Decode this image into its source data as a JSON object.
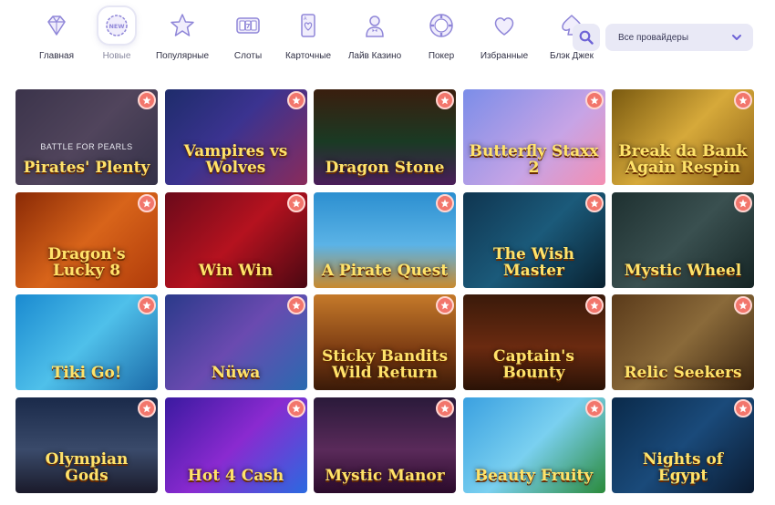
{
  "nav": {
    "items": [
      {
        "label": "Главная",
        "icon": "diamond-icon"
      },
      {
        "label": "Новые",
        "icon": "new-badge-icon",
        "active": true
      },
      {
        "label": "Популярные",
        "icon": "star-icon"
      },
      {
        "label": "Слоты",
        "icon": "slot-machine-icon"
      },
      {
        "label": "Карточные",
        "icon": "playing-card-icon"
      },
      {
        "label": "Лайв Казино",
        "icon": "dealer-icon"
      },
      {
        "label": "Покер",
        "icon": "poker-chip-icon"
      },
      {
        "label": "Избранные",
        "icon": "heart-icon"
      },
      {
        "label": "Блэк Джек",
        "icon": "spade-card-icon"
      }
    ]
  },
  "search": {
    "icon": "search-icon"
  },
  "providers": {
    "selected": "Все провайдеры",
    "icon": "chevron-down-icon"
  },
  "colors": {
    "accent": "#6d63d6",
    "badge": "#f2766c",
    "bar_bg": "#e9e9f6"
  },
  "games": [
    {
      "title": "Pirates' Plenty",
      "hover_text": "BATTLE FOR PEARLS",
      "overlay": true,
      "bg": "linear-gradient(135deg,#3b2a3a,#6a5060 50%,#2b2433)"
    },
    {
      "title": "Vampires vs Wolves",
      "bg": "linear-gradient(135deg,#1e2c6b,#3b3390 45%,#8a2b5b)"
    },
    {
      "title": "Dragon Stone",
      "bg": "linear-gradient(180deg,#3a1e0e,#1a3a24 55%,#4a1d5a)"
    },
    {
      "title": "Butterfly Staxx 2",
      "bg": "linear-gradient(135deg,#7b8de8,#c7a4e6 60%,#f48fb1)"
    },
    {
      "title": "Break da Bank Again Respin",
      "bg": "linear-gradient(135deg,#7a5a10,#d6a93a 50%,#8a5f15)"
    },
    {
      "title": "Dragon's Lucky 8",
      "bg": "linear-gradient(135deg,#8a2a06,#d8641a 50%,#b03b0a)"
    },
    {
      "title": "Win Win",
      "bg": "linear-gradient(135deg,#6a0a1a,#b5121f 50%,#4a0812)"
    },
    {
      "title": "A Pirate Quest",
      "bg": "linear-gradient(180deg,#2c8fd0,#5bb3e6 55%,#c88a2e)"
    },
    {
      "title": "The Wish Master",
      "bg": "linear-gradient(135deg,#0f3550,#1b5a7a 50%,#08202f)"
    },
    {
      "title": "Mystic Wheel",
      "bg": "linear-gradient(135deg,#1e3030,#3a5050 50%,#152424)"
    },
    {
      "title": "Tiki Go!",
      "bg": "linear-gradient(135deg,#1a8ad0,#4fc0ea 50%,#1b6aa8)"
    },
    {
      "title": "Nüwa",
      "bg": "linear-gradient(135deg,#2a3a8a,#6a4ab0 50%,#2a6ab0)"
    },
    {
      "title": "Sticky Bandits Wild Return",
      "bg": "linear-gradient(180deg,#c57a2a,#7a3a12 60%,#3a1a08)"
    },
    {
      "title": "Captain's Bounty",
      "bg": "linear-gradient(180deg,#3a1a0a,#6a2a10 55%,#2a1206)"
    },
    {
      "title": "Relic Seekers",
      "bg": "linear-gradient(135deg,#5a3a1a,#8a6a3a 50%,#3a2410)"
    },
    {
      "title": "Olympian Gods",
      "bg": "linear-gradient(180deg,#1a2a4a,#3a4a6a 55%,#1a1a2a)"
    },
    {
      "title": "Hot 4 Cash",
      "bg": "linear-gradient(135deg,#3a1aa0,#8a2ad0 50%,#2a6ae0)"
    },
    {
      "title": "Mystic Manor",
      "bg": "linear-gradient(180deg,#2a1a3a,#5a2a5a 55%,#2a0a2a)"
    },
    {
      "title": "Beauty Fruity",
      "bg": "linear-gradient(135deg,#3aa0e0,#7ad0f0 50%,#2a8a3a)"
    },
    {
      "title": "Nights of Egypt",
      "bg": "linear-gradient(135deg,#0a2a4a,#1a4a7a 50%,#0a1a30)"
    }
  ]
}
